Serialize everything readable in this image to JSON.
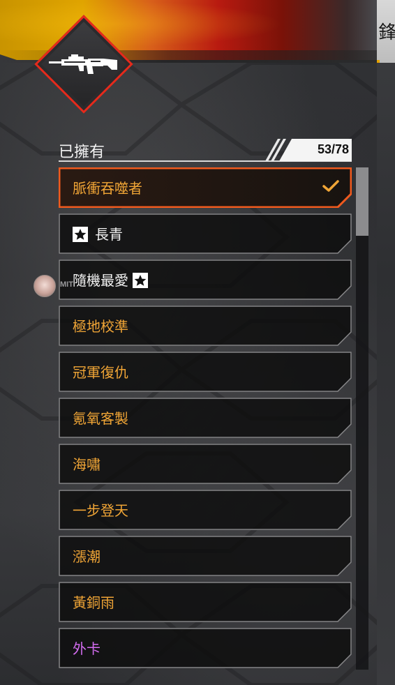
{
  "header": {
    "owned_label": "已擁有",
    "count": "53/78",
    "right_edge_char": "鋒"
  },
  "overlay": {
    "avatar_name": "MIT"
  },
  "items": [
    {
      "label": "脈衝吞噬者",
      "color": "#f0a536",
      "selected": true,
      "star": null
    },
    {
      "label": "長青",
      "color": "#f2f2f2",
      "selected": false,
      "star": "before"
    },
    {
      "label": "隨機最愛",
      "color": "#f2f2f2",
      "selected": false,
      "star": "after"
    },
    {
      "label": "極地校準",
      "color": "#f0a536",
      "selected": false,
      "star": null
    },
    {
      "label": "冠軍復仇",
      "color": "#f0a536",
      "selected": false,
      "star": null
    },
    {
      "label": "氪氧客製",
      "color": "#f0a536",
      "selected": false,
      "star": null
    },
    {
      "label": "海嘯",
      "color": "#f0a536",
      "selected": false,
      "star": null
    },
    {
      "label": "一步登天",
      "color": "#f0a536",
      "selected": false,
      "star": null
    },
    {
      "label": "漲潮",
      "color": "#f0a536",
      "selected": false,
      "star": null
    },
    {
      "label": "黃銅雨",
      "color": "#f0a536",
      "selected": false,
      "star": null
    },
    {
      "label": "外卡",
      "color": "#d36cf0",
      "selected": false,
      "star": null
    }
  ],
  "colors": {
    "accent_orange": "#f05a1e",
    "legendary_gold": "#f0a536",
    "epic_purple": "#d36cf0",
    "emblem_red": "#e52a1c"
  },
  "icons": {
    "emblem": "assault-rifle-icon",
    "selected_mark": "checkmark-icon",
    "favorite_mark": "star-badge-icon"
  }
}
